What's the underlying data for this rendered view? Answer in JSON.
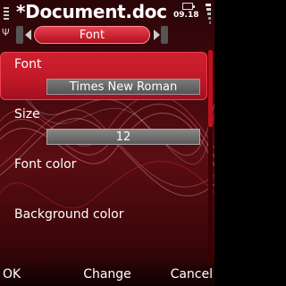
{
  "title_bar": {
    "document_title": "*Document.doc",
    "clock": "09.18"
  },
  "tab": {
    "label": "Font"
  },
  "settings": {
    "font": {
      "label": "Font",
      "value": "Times New Roman"
    },
    "size": {
      "label": "Size",
      "value": "12"
    },
    "font_color": {
      "label": "Font color"
    },
    "background_color": {
      "label": "Background color"
    }
  },
  "softkeys": {
    "left": "OK",
    "middle": "Change",
    "right": "Cancel"
  },
  "colors": {
    "accent": "#d02030",
    "background": "#3a070b"
  },
  "icons": [
    "signal-icon",
    "battery-icon",
    "arrow-left-icon",
    "arrow-right-icon",
    "antenna-icon"
  ]
}
